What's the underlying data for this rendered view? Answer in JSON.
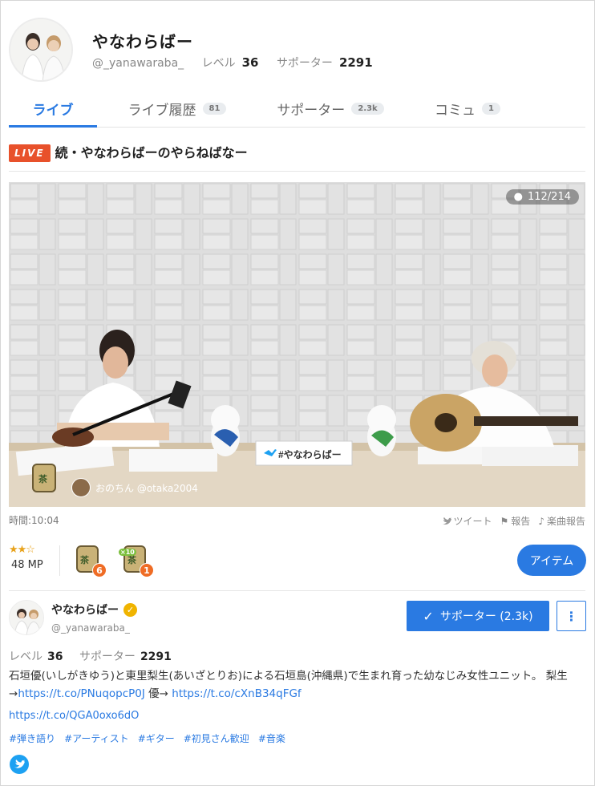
{
  "profile": {
    "name": "やなわらばー",
    "handle": "@_yanawaraba_",
    "level_label": "レベル",
    "level_value": "36",
    "supporter_label": "サポーター",
    "supporter_value": "2291"
  },
  "tabs": [
    {
      "label": "ライブ",
      "count": ""
    },
    {
      "label": "ライブ履歴",
      "count": "81"
    },
    {
      "label": "サポーター",
      "count": "2.3k"
    },
    {
      "label": "コミュ",
      "count": "1"
    }
  ],
  "live": {
    "badge": "LIVE",
    "title": "続・やなわらばーのやらねばなー",
    "viewers": "112/214",
    "tweet_sign": "#やなわらばー",
    "overlay_user": "おのちん @otaka2004",
    "time": "時間:10:04"
  },
  "actions": {
    "tweet": "ツイート",
    "report": "報告",
    "music_report": "楽曲報告"
  },
  "items": {
    "mp": "48 MP",
    "gift_label": "茶",
    "gift1_count": "6",
    "gift2_multiplier": "×10",
    "gift2_count": "1",
    "item_button": "アイテム"
  },
  "channel": {
    "name": "やなわらばー",
    "handle": "@_yanawaraba_",
    "supporter_button": "サポーター (2.3k)",
    "level_label": "レベル",
    "level_value": "36",
    "supporter_label": "サポーター",
    "supporter_value": "2291",
    "desc_text1": "石垣優(いしがきゆう)と東里梨生(あいざとりお)による石垣島(沖縄県)で生まれ育った幼なじみ女性ユニット。 梨生→",
    "desc_link1": "https://t.co/PNuqopcP0J",
    "desc_text2": " 優→ ",
    "desc_link2": "https://t.co/cXnB34qFGf",
    "link": "https://t.co/QGA0oxo6dO",
    "tags": [
      "#弾き語り",
      "#アーティスト",
      "#ギター",
      "#初見さん歓迎",
      "#音楽"
    ]
  },
  "colors": {
    "accent": "#2a7ae2",
    "live_badge": "#e8512b",
    "verified": "#f0b400"
  }
}
